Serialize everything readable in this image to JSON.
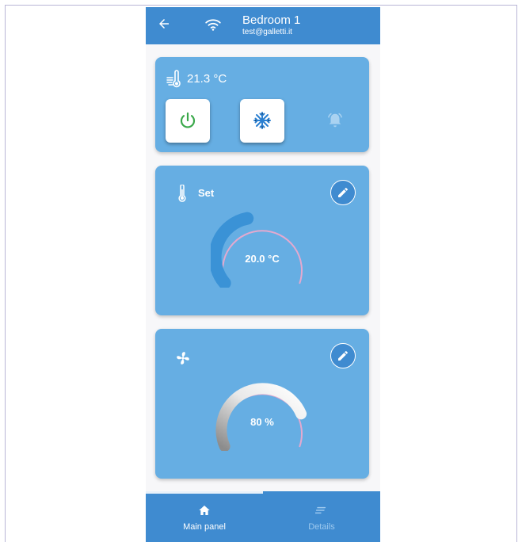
{
  "header": {
    "title": "Bedroom 1",
    "subtitle": "test@galletti.it",
    "back_icon": "arrow-left-icon",
    "status_icon": "wifi-icon"
  },
  "status_card": {
    "temperature": "21.3 °C",
    "power_icon": "power-icon",
    "mode_icon": "snowflake-icon",
    "alarm_icon": "bell-icon"
  },
  "setpoint_card": {
    "label": "Set",
    "value": "20.0 °C",
    "level_percent": 35
  },
  "fan_card": {
    "value": "80 %",
    "level_percent": 80
  },
  "nav": {
    "main_label": "Main panel",
    "details_label": "Details"
  },
  "colors": {
    "appbar": "#3f8bd0",
    "card": "#66aee3",
    "power_green": "#3aa84a",
    "mode_blue": "#2a7fd1",
    "arc_pink": "#e4a9cf"
  }
}
